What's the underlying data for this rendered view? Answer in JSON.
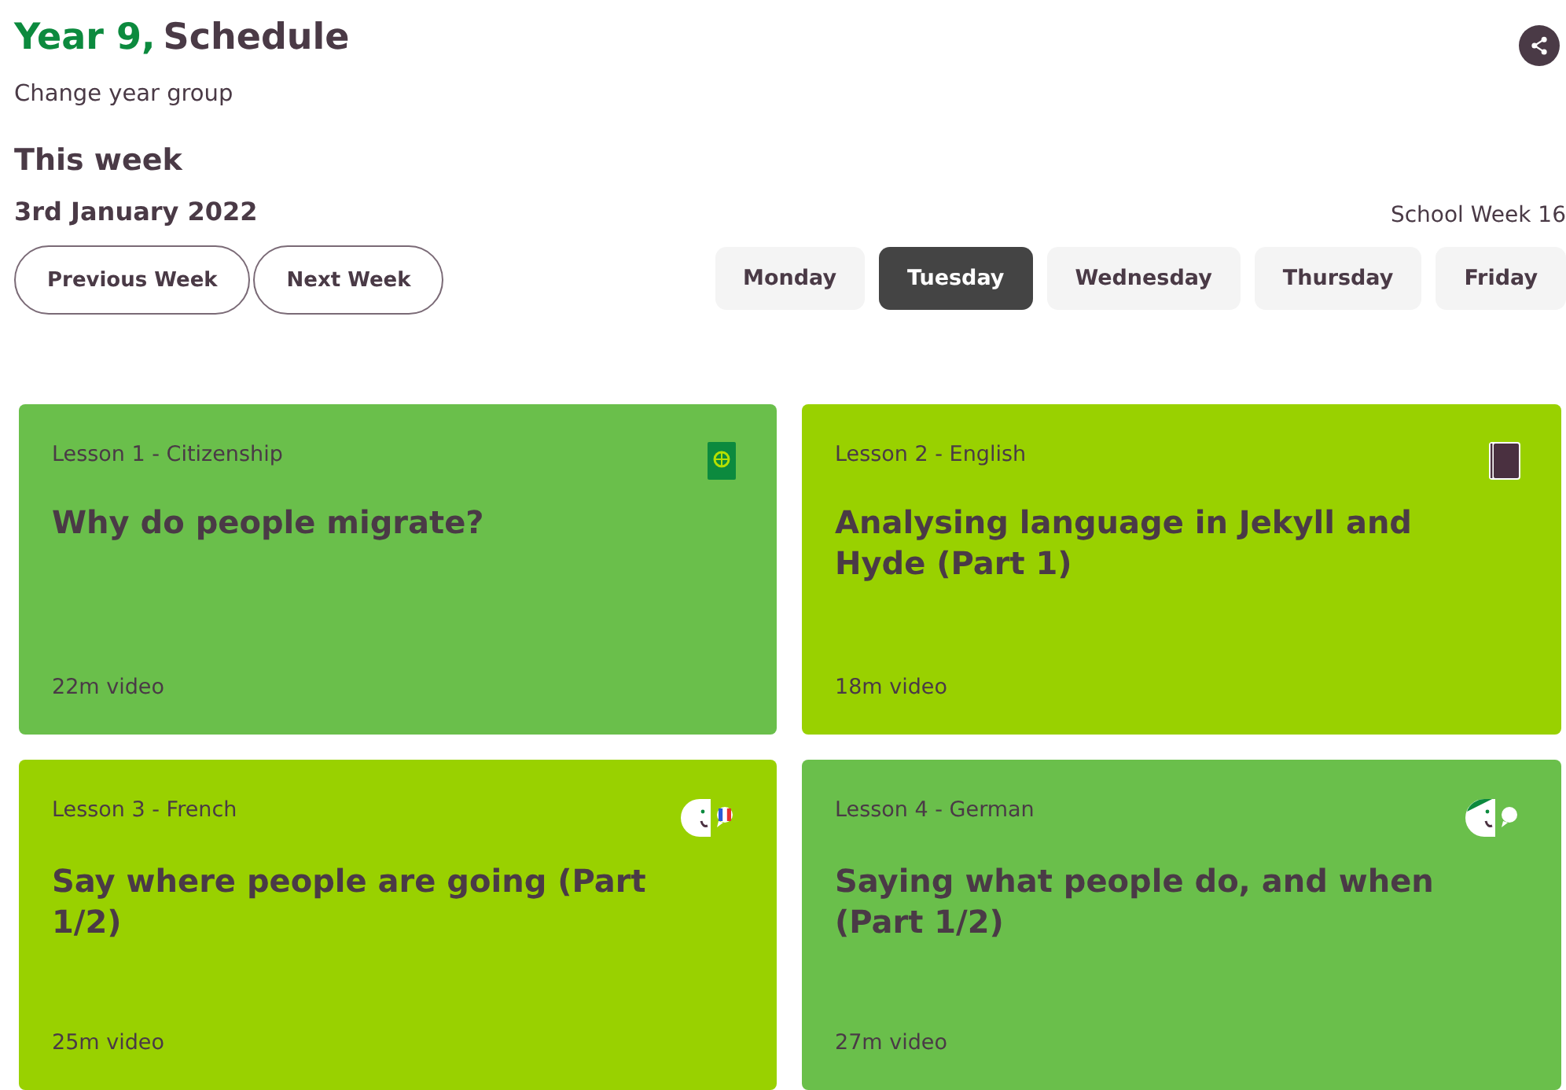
{
  "header": {
    "year": "Year 9,",
    "title": "Schedule",
    "change_link": "Change year group"
  },
  "week": {
    "heading": "This week",
    "date": "3rd January 2022",
    "school_week": "School Week 16"
  },
  "week_buttons": [
    "Previous Week",
    "Next Week"
  ],
  "days": [
    {
      "label": "Monday",
      "selected": false
    },
    {
      "label": "Tuesday",
      "selected": true
    },
    {
      "label": "Wednesday",
      "selected": false
    },
    {
      "label": "Thursday",
      "selected": false
    },
    {
      "label": "Friday",
      "selected": false
    }
  ],
  "lessons": [
    {
      "label": "Lesson 1 - Citizenship",
      "title": "Why do people migrate?",
      "duration": "22m video",
      "color": "#6abf4b",
      "kind": "passport"
    },
    {
      "label": "Lesson 2 - English",
      "title": "Analysing language in Jekyll and Hyde (Part 1)",
      "duration": "18m video",
      "color": "#99d100",
      "kind": "book"
    },
    {
      "label": "Lesson 3 - French",
      "title": "Say where people are going (Part 1/2)",
      "duration": "25m video",
      "color": "#99d100",
      "kind": "speaker-french"
    },
    {
      "label": "Lesson 4 - German",
      "title": "Saying what people do, and when (Part 1/2)",
      "duration": "27m video",
      "color": "#6abf4b",
      "kind": "speaker-german"
    }
  ]
}
